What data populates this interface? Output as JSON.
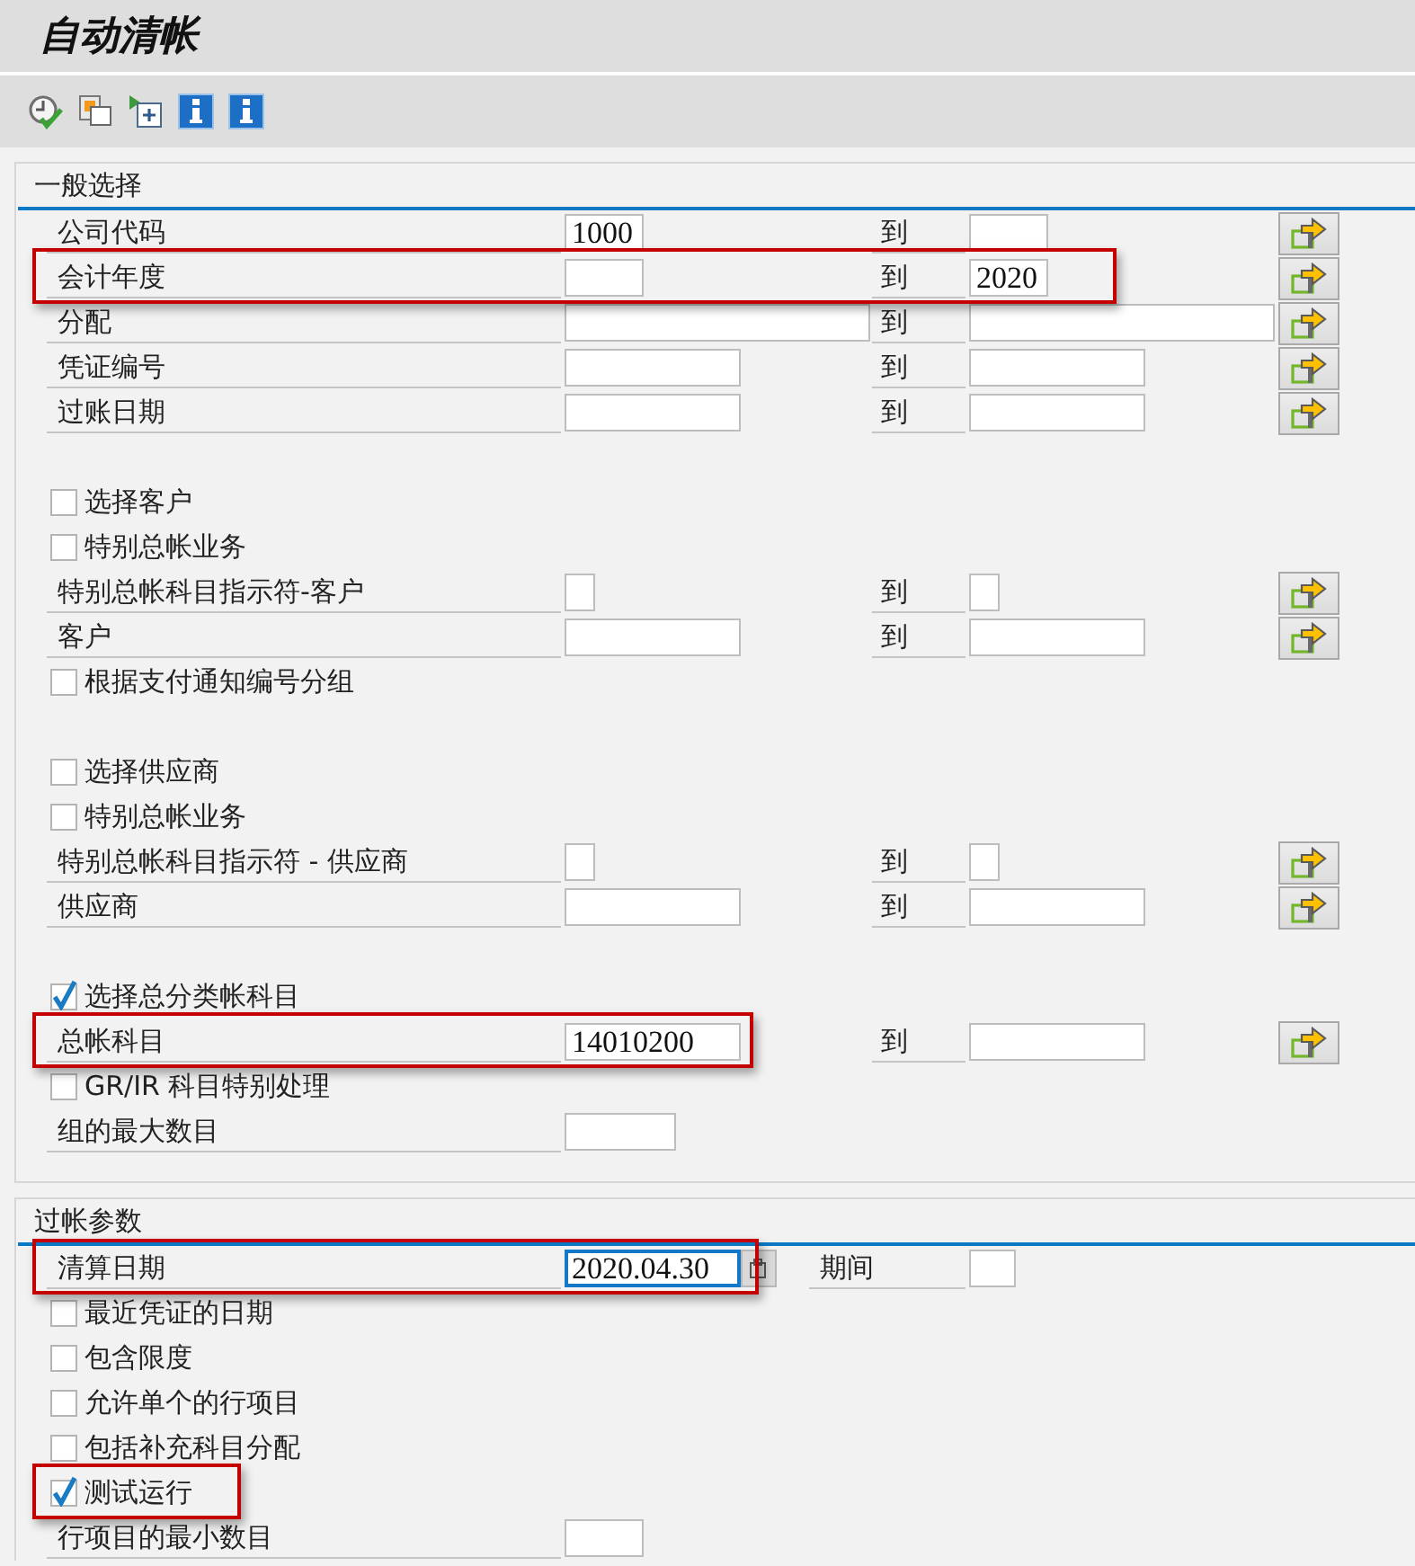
{
  "window": {
    "title": "自动清帐"
  },
  "sections": [
    {
      "title": "一般选择",
      "groups": [
        {
          "rows": [
            {
              "kind": "range",
              "label": "公司代码",
              "from": "1000",
              "to_label": "到",
              "highlighted": false
            },
            {
              "kind": "range",
              "label": "会计年度",
              "to_label": "到",
              "to": "2020",
              "highlighted": true
            },
            {
              "kind": "range",
              "label": "分配",
              "to_label": "到",
              "highlighted": false
            },
            {
              "kind": "range",
              "label": "凭证编号",
              "to_label": "到",
              "highlighted": false
            },
            {
              "kind": "range",
              "label": "过账日期",
              "to_label": "到",
              "highlighted": false
            }
          ]
        },
        {
          "rows": [
            {
              "kind": "checkbox",
              "label": "选择客户",
              "checked": false,
              "highlighted": false
            },
            {
              "kind": "checkbox",
              "label": "特别总帐业务",
              "checked": false,
              "highlighted": false
            },
            {
              "kind": "range",
              "label": "特别总帐科目指示符-客户",
              "to_label": "到",
              "highlighted": false
            },
            {
              "kind": "range",
              "label": "客户",
              "to_label": "到",
              "highlighted": false
            },
            {
              "kind": "checkbox",
              "label": "根据支付通知编号分组",
              "checked": false,
              "highlighted": false
            }
          ]
        },
        {
          "rows": [
            {
              "kind": "checkbox",
              "label": "选择供应商",
              "checked": false,
              "highlighted": false
            },
            {
              "kind": "checkbox",
              "label": "特别总帐业务",
              "checked": false,
              "highlighted": false
            },
            {
              "kind": "range",
              "label": "特别总帐科目指示符 - 供应商",
              "to_label": "到",
              "highlighted": false
            },
            {
              "kind": "range",
              "label": "供应商",
              "to_label": "到",
              "highlighted": false
            }
          ]
        },
        {
          "rows": [
            {
              "kind": "checkbox",
              "label": "选择总分类帐科目",
              "checked": true,
              "highlighted": false
            },
            {
              "kind": "range",
              "label": "总帐科目",
              "from": "14010200",
              "to_label": "到",
              "highlighted": true
            },
            {
              "kind": "checkbox",
              "label": "GR/IR 科目特别处理",
              "checked": false,
              "highlighted": false
            },
            {
              "kind": "single",
              "label": "组的最大数目",
              "highlighted": false
            }
          ]
        }
      ]
    },
    {
      "title": "过帐参数",
      "groups": [
        {
          "rows": [
            {
              "kind": "date",
              "label": "清算日期",
              "value": "2020.04.30",
              "focused": true,
              "highlighted": true,
              "period_label": "期间"
            },
            {
              "kind": "checkbox",
              "label": "最近凭证的日期",
              "checked": false,
              "highlighted": false
            },
            {
              "kind": "checkbox",
              "label": "包含限度",
              "checked": false,
              "highlighted": false
            },
            {
              "kind": "checkbox",
              "label": "允许单个的行项目",
              "checked": false,
              "highlighted": false
            },
            {
              "kind": "checkbox",
              "label": "包括补充科目分配",
              "checked": false,
              "highlighted": false
            },
            {
              "kind": "checkbox",
              "label": "测试运行",
              "checked": true,
              "highlighted": true
            },
            {
              "kind": "single",
              "label": "行项目的最小数目",
              "highlighted": false
            }
          ]
        }
      ]
    }
  ]
}
